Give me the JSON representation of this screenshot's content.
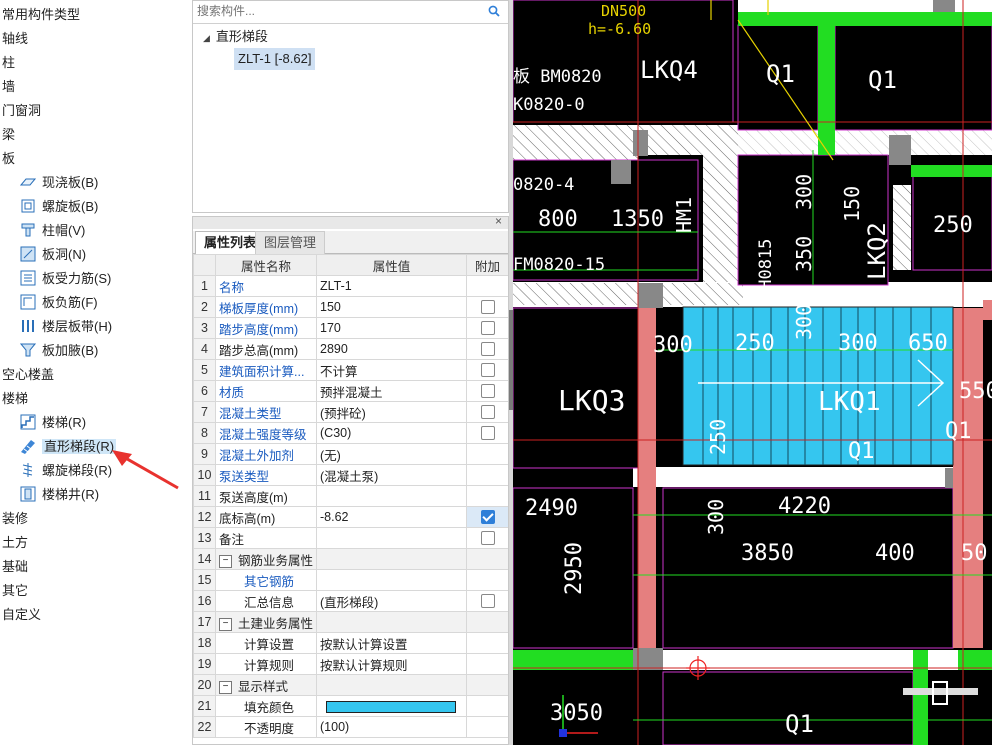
{
  "tree": {
    "categories": [
      "常用构件类型",
      "轴线",
      "柱",
      "墙",
      "门窗洞",
      "梁",
      "板",
      "空心楼盖",
      "楼梯",
      "装修",
      "土方",
      "基础",
      "其它",
      "自定义"
    ],
    "board_items": [
      "现浇板(B)",
      "螺旋板(B)",
      "柱帽(V)",
      "板洞(N)",
      "板受力筋(S)",
      "板负筋(F)",
      "楼层板带(H)",
      "板加腋(B)"
    ],
    "stair_items": [
      "楼梯(R)",
      "直形梯段(R)",
      "螺旋梯段(R)",
      "楼梯井(R)"
    ],
    "selected": "直形梯段(R)"
  },
  "component_list": {
    "search_placeholder": "搜索构件...",
    "group": "直形梯段",
    "item": "ZLT-1 [-8.62]"
  },
  "properties": {
    "tabs": [
      "属性列表",
      "图层管理"
    ],
    "columns": [
      "属性名称",
      "属性值",
      "附加"
    ],
    "rows": [
      {
        "n": "1",
        "name": "名称",
        "value": "ZLT-1",
        "blue": true,
        "check": null
      },
      {
        "n": "2",
        "name": "梯板厚度(mm)",
        "value": "150",
        "blue": true,
        "check": false
      },
      {
        "n": "3",
        "name": "踏步高度(mm)",
        "value": "170",
        "blue": true,
        "check": false
      },
      {
        "n": "4",
        "name": "踏步总高(mm)",
        "value": "2890",
        "blue": false,
        "check": false
      },
      {
        "n": "5",
        "name": "建筑面积计算...",
        "value": "不计算",
        "blue": true,
        "check": false
      },
      {
        "n": "6",
        "name": "材质",
        "value": "预拌混凝土",
        "blue": true,
        "check": false
      },
      {
        "n": "7",
        "name": "混凝土类型",
        "value": "(预拌砼)",
        "blue": true,
        "check": false
      },
      {
        "n": "8",
        "name": "混凝土强度等级",
        "value": "(C30)",
        "blue": true,
        "check": false
      },
      {
        "n": "9",
        "name": "混凝土外加剂",
        "value": "(无)",
        "blue": true,
        "check": null
      },
      {
        "n": "10",
        "name": "泵送类型",
        "value": "(混凝土泵)",
        "blue": true,
        "check": null
      },
      {
        "n": "11",
        "name": "泵送高度(m)",
        "value": "",
        "blue": false,
        "check": null
      },
      {
        "n": "12",
        "name": "底标高(m)",
        "value": "-8.62",
        "blue": false,
        "check": true
      },
      {
        "n": "13",
        "name": "备注",
        "value": "",
        "blue": false,
        "check": false
      },
      {
        "n": "14",
        "name": "钢筋业务属性",
        "value": "",
        "blue": false,
        "check": null,
        "section": true
      },
      {
        "n": "15",
        "name": "其它钢筋",
        "value": "",
        "blue": true,
        "check": null,
        "indent": true
      },
      {
        "n": "16",
        "name": "汇总信息",
        "value": "(直形梯段)",
        "blue": false,
        "check": false,
        "indent": true
      },
      {
        "n": "17",
        "name": "土建业务属性",
        "value": "",
        "blue": false,
        "check": null,
        "section": true
      },
      {
        "n": "18",
        "name": "计算设置",
        "value": "按默认计算设置",
        "blue": false,
        "check": null,
        "indent": true
      },
      {
        "n": "19",
        "name": "计算规则",
        "value": "按默认计算规则",
        "blue": false,
        "check": null,
        "indent": true
      },
      {
        "n": "20",
        "name": "显示样式",
        "value": "",
        "blue": false,
        "check": null,
        "section": true
      },
      {
        "n": "21",
        "name": "填充颜色",
        "value": "",
        "blue": false,
        "check": null,
        "indent": true,
        "swatch": true
      },
      {
        "n": "22",
        "name": "不透明度",
        "value": "(100)",
        "blue": false,
        "check": null,
        "indent": true
      }
    ],
    "fill_color": "#35c6ef"
  },
  "cad": {
    "labels": [
      "DN500",
      "h=-6.60",
      "LKQ4",
      "Q1",
      "Q1",
      "板 BM0820",
      "K0820-0",
      "0820-4",
      "800",
      "1350",
      "HM1",
      "MH0815",
      "300",
      "150",
      "350",
      "LKQ2",
      "250",
      "FM0820-15",
      "300",
      "250",
      "300",
      "300",
      "650",
      "LKQ3",
      "LKQ1",
      "550",
      "Q1",
      "250",
      "Q1",
      "Q1",
      "2490",
      "4220",
      "300",
      "3850",
      "400",
      "50",
      "2950",
      "3050",
      "Q1"
    ]
  }
}
